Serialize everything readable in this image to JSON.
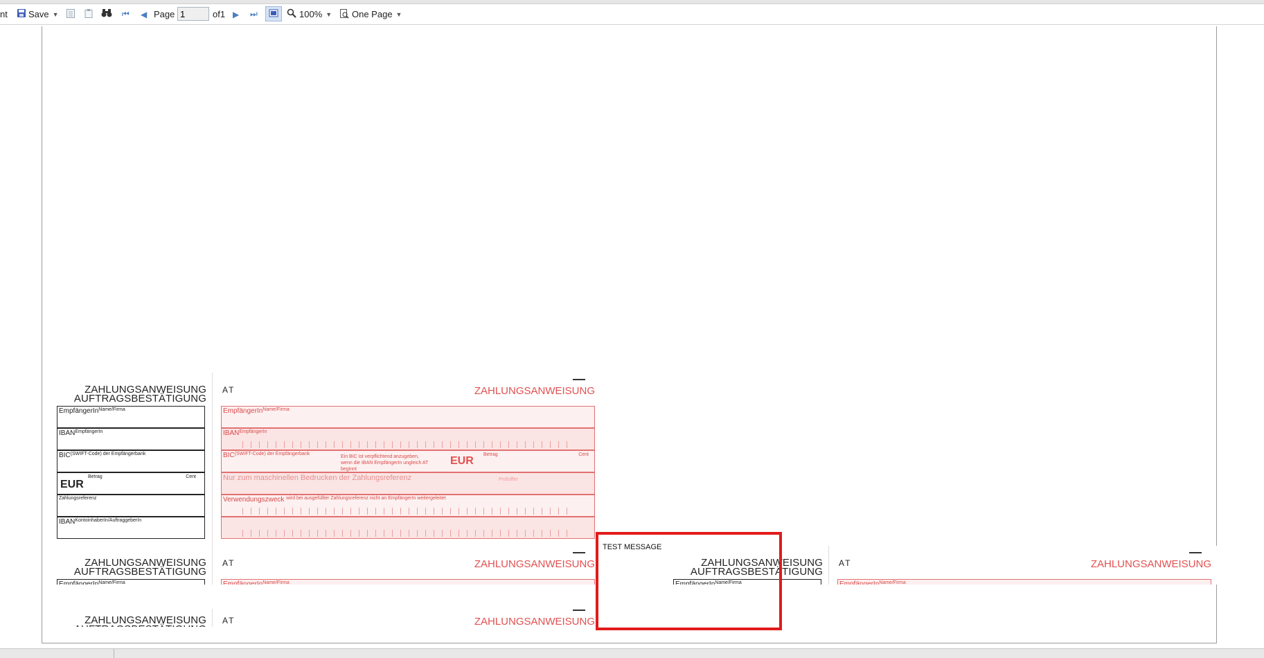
{
  "toolbar": {
    "print_label": "nt",
    "save_label": "Save",
    "page_label": "Page",
    "page_value": "1",
    "of_label": "of1",
    "zoom_label": "100%",
    "view_label": "One Page"
  },
  "forms": {
    "stub_title_1": "ZAHLUNGSANWEISUNG",
    "stub_title_2": "AUFTRAGSBESTÄTIGUNG",
    "country": "AT",
    "main_title": "ZAHLUNGSANWEISUNG",
    "empfaenger": "EmpfängerIn",
    "empfaenger_sup": "Name/Firma",
    "iban": "IBAN",
    "iban_sup": "EmpfängerIn",
    "bic": "BIC",
    "bic_sup": "(SWIFT-Code) der Empfängerbank",
    "eur": "EUR",
    "betrag": "Betrag",
    "cent": "Cent",
    "zahlungsreferenz": "Zahlungsreferenz",
    "iban_kontoinhaber": "IBAN",
    "iban_kontoinhaber_sup": "KontoinhaberIn/AuftraggeberIn",
    "bic_note": "Ein BIC ist verpflichtend anzugeben, wenn die IBAN EmpfängerIn ungleich AT beginnt",
    "ref_placeholder": "Nur zum maschinellen Bedrucken der Zahlungsreferenz",
    "pruefziffer": "Prüfziffer",
    "verwendungszweck": "Verwendungszweck",
    "verwendungszweck_note": "wird bei ausgefüllter Zahlungsreferenz nicht an EmpfängerIn weitergeleitet"
  },
  "annotation": {
    "test_message": "TEST MESSAGE"
  },
  "colors": {
    "form_red": "#e25050",
    "highlight_red": "#e11b1b"
  }
}
